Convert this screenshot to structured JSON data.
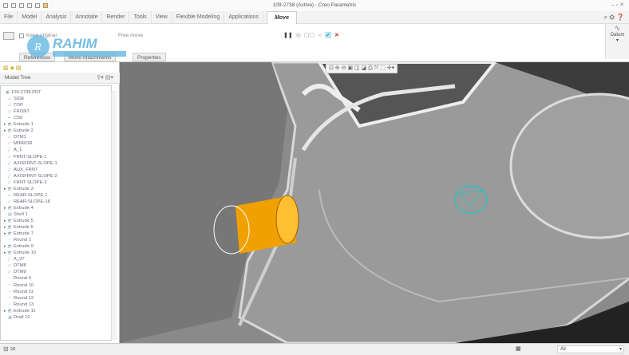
{
  "window": {
    "title": "109-2738 (Active) - Creo Parametric"
  },
  "tabs": [
    {
      "label": "File"
    },
    {
      "label": "Model"
    },
    {
      "label": "Analysis"
    },
    {
      "label": "Annotate"
    },
    {
      "label": "Render"
    },
    {
      "label": "Tools"
    },
    {
      "label": "View"
    },
    {
      "label": "Flexible Modeling"
    },
    {
      "label": "Applications"
    },
    {
      "label": "Move",
      "active": true
    }
  ],
  "ribbon": {
    "keep_original": "Keep original",
    "free_move": "Free move",
    "datum_label": "Datum",
    "dashboard_tabs": [
      "References",
      "Move Attachments",
      "Properties"
    ]
  },
  "watermark": {
    "text": "RAHIM",
    "subtext": "SOFTWARE"
  },
  "model_tree": {
    "title": "Model Tree",
    "items": [
      {
        "label": "109-2738.PRT",
        "icon": "part-icon"
      },
      {
        "label": "SIDE",
        "icon": "plane-icon"
      },
      {
        "label": "TOP",
        "icon": "plane-icon"
      },
      {
        "label": "FRONT",
        "icon": "plane-icon"
      },
      {
        "label": "CS0",
        "icon": "csys-icon"
      },
      {
        "label": "Extrude 1",
        "icon": "extrude-icon",
        "expand": true
      },
      {
        "label": "Extrude 2",
        "icon": "extrude-icon",
        "expand": true
      },
      {
        "label": "DTM1",
        "icon": "plane-icon"
      },
      {
        "label": "MIRROR",
        "icon": "plane-icon"
      },
      {
        "label": "A_1",
        "icon": "axis-icon"
      },
      {
        "label": "FRNT-SLOPE-1",
        "icon": "plane-icon"
      },
      {
        "label": "AXISFRNT-SLOPE-1",
        "icon": "axis-icon"
      },
      {
        "label": "AUX_FRNT",
        "icon": "plane-icon"
      },
      {
        "label": "AXISFRNT-SLOPE-2",
        "icon": "axis-icon"
      },
      {
        "label": "FRNT-SLOPE-2",
        "icon": "plane-icon"
      },
      {
        "label": "Extrude 3",
        "icon": "extrude-icon",
        "expand": true
      },
      {
        "label": "REAR-SLOPE-1",
        "icon": "plane-icon"
      },
      {
        "label": "REAR-SLOPE-18",
        "icon": "plane-icon"
      },
      {
        "label": "Extrude 4",
        "icon": "extrude-icon",
        "expand": true
      },
      {
        "label": "Shell 1",
        "icon": "shell-icon"
      },
      {
        "label": "Extrude 5",
        "icon": "extrude-icon",
        "expand": true
      },
      {
        "label": "Extrude 6",
        "icon": "extrude-icon",
        "expand": true
      },
      {
        "label": "Extrude 7",
        "icon": "extrude-icon",
        "expand": true
      },
      {
        "label": "Round 1",
        "icon": "round-icon"
      },
      {
        "label": "Extrude 9",
        "icon": "extrude-icon",
        "expand": true
      },
      {
        "label": "Extrude 10",
        "icon": "extrude-icon",
        "expand": true
      },
      {
        "label": "A_37",
        "icon": "axis-icon"
      },
      {
        "label": "DTM8",
        "icon": "plane-icon"
      },
      {
        "label": "DTM9",
        "icon": "plane-icon"
      },
      {
        "label": "Round 9",
        "icon": "round-icon"
      },
      {
        "label": "Round 10",
        "icon": "round-icon"
      },
      {
        "label": "Round 11",
        "icon": "round-icon"
      },
      {
        "label": "Round 12",
        "icon": "round-icon"
      },
      {
        "label": "Round 13",
        "icon": "round-icon"
      },
      {
        "label": "Extrude 11",
        "icon": "extrude-icon",
        "expand": true
      },
      {
        "label": "Draft 10",
        "icon": "draft-icon"
      }
    ]
  },
  "status": {
    "filter": "All"
  },
  "colors": {
    "accent_orange": "#f0a000",
    "accent_cyan": "#30c0c0",
    "confirm": "#2aa0c8",
    "cancel": "#c0302a"
  }
}
